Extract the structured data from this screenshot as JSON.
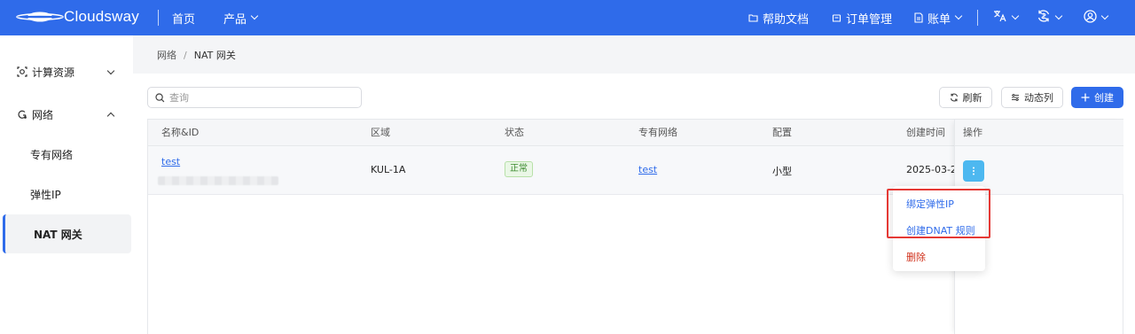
{
  "topbar": {
    "brand": "Cloudsway",
    "home": "首页",
    "products": "产品",
    "help_docs": "帮助文档",
    "order_mgmt": "订单管理",
    "billing": "账单",
    "bg_color": "#2f6bea"
  },
  "sidebar": {
    "items": [
      {
        "label": "计算资源",
        "icon": "compute-icon",
        "expanded": false
      },
      {
        "label": "网络",
        "icon": "network-icon",
        "expanded": true
      },
      {
        "label": "专有网络"
      },
      {
        "label": "弹性IP"
      },
      {
        "label": "NAT 网关",
        "active": true
      }
    ]
  },
  "breadcrumb": {
    "parent": "网络",
    "separator": "/",
    "current": "NAT 网关"
  },
  "toolbar": {
    "search_placeholder": "查询",
    "refresh_label": "刷新",
    "columns_label": "动态列",
    "create_label": "创建"
  },
  "table": {
    "headers": [
      "名称&ID",
      "区域",
      "状态",
      "专有网络",
      "配置",
      "创建时间",
      "操作"
    ],
    "rows": [
      {
        "name": "test",
        "region": "KUL-1A",
        "status": "正常",
        "vpc": "test",
        "spec": "小型",
        "created": "2025-03-2"
      }
    ]
  },
  "menu": {
    "items": [
      "绑定弹性IP",
      "创建DNAT 规则",
      "删除"
    ]
  },
  "colors": {
    "accent": "#2f6bea",
    "more_button": "#4db8f0",
    "danger": "#d0301b",
    "status_ok": "#3a8a2c",
    "highlight_box": "#e53935"
  }
}
